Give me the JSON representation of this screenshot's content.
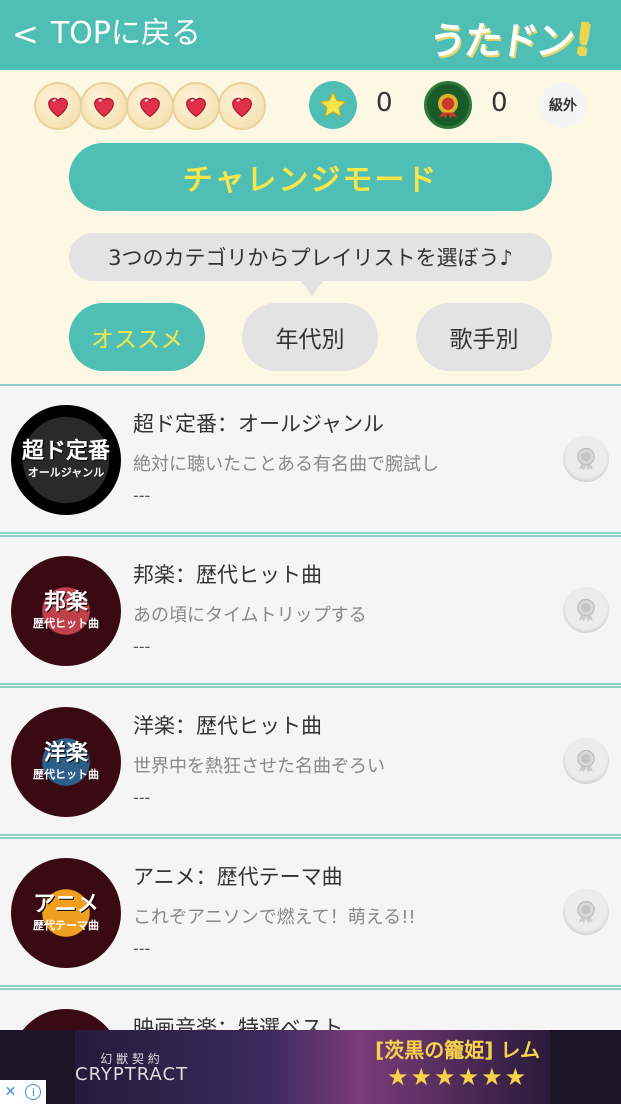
{
  "header": {
    "back_label": "TOPに戻る",
    "logo_text": "うたドン",
    "logo_mark": "!"
  },
  "status": {
    "hearts": 5,
    "stars": "0",
    "medals": "0",
    "rank": "級外"
  },
  "challenge_button": "チャレンジモード",
  "prompt": "3つのカテゴリからプレイリストを選ぼう♪",
  "tabs": [
    {
      "label": "オススメ",
      "active": true
    },
    {
      "label": "年代別",
      "active": false
    },
    {
      "label": "歌手別",
      "active": false
    }
  ],
  "playlists": [
    {
      "title": "超ド定番：オールジャンル",
      "desc": "絶対に聴いたことある有名曲で腕試し",
      "score": "---",
      "thumb_main": "超ド定番",
      "thumb_sub": "オールジャンル",
      "ring": "#000000",
      "inner": "#1a1a1a"
    },
    {
      "title": "邦楽：歴代ヒット曲",
      "desc": "あの頃にタイムトリップする",
      "score": "---",
      "thumb_main": "邦楽",
      "thumb_sub": "歴代ヒット曲",
      "ring": "#c0404a",
      "inner": "#3a0a14"
    },
    {
      "title": "洋楽：歴代ヒット曲",
      "desc": "世界中を熱狂させた名曲ぞろい",
      "score": "---",
      "thumb_main": "洋楽",
      "thumb_sub": "歴代ヒット曲",
      "ring": "#2c5f8a",
      "inner": "#3a0a14"
    },
    {
      "title": "アニメ：歴代テーマ曲",
      "desc": "これぞアニソンで燃えて！萌える!!",
      "score": "---",
      "thumb_main": "アニメ",
      "thumb_sub": "歴代テーマ曲",
      "ring": "#f0a020",
      "inner": "#3a0a14"
    },
    {
      "title": "映画音楽：特選ベスト",
      "desc": "",
      "score": "",
      "thumb_main": "",
      "thumb_sub": "",
      "ring": "#7a4a1a",
      "inner": "#3a0a14"
    }
  ],
  "ad": {
    "brand_top": "幻 獣 契 約",
    "brand": "CRYPTRACT",
    "title": "[茨黒の籠姫] レム",
    "stars": "★★★★★★"
  },
  "colors": {
    "accent": "#4fbfb5",
    "highlight": "#f6e64a",
    "background": "#fdf8e3"
  }
}
